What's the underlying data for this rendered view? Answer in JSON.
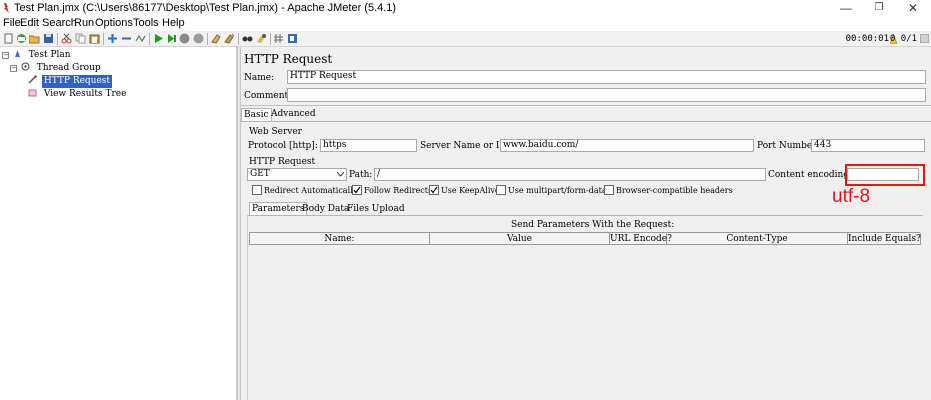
{
  "window": {
    "title": "Test Plan.jmx (C:\\Users\\86177\\Desktop\\Test Plan.jmx) - Apache JMeter (5.4.1)",
    "minimize_glyph": "—",
    "maximize_glyph": "❐",
    "close_glyph": "✕"
  },
  "menu": [
    "File",
    "Edit",
    "Search",
    "Run",
    "Options",
    "Tools",
    "Help"
  ],
  "toolbar": {
    "timer": "00:00:01",
    "thread_count": "0 0/1",
    "icons": [
      "new-icon",
      "templates-icon",
      "open-icon",
      "save-icon",
      "cut-icon",
      "copy-icon",
      "paste-icon",
      "expand-icon",
      "collapse-icon",
      "toggle-icon",
      "start-icon",
      "start-no-pause-icon",
      "stop-icon",
      "shutdown-icon",
      "clear-icon",
      "clear-all-icon",
      "search-icon",
      "reset-search-icon",
      "function-helper-icon",
      "help-icon"
    ]
  },
  "tree": {
    "items": [
      {
        "label": "Test Plan",
        "level": 0,
        "expander": "−",
        "icon": "test-plan-icon"
      },
      {
        "label": "Thread Group",
        "level": 1,
        "expander": "−",
        "icon": "thread-group-icon"
      },
      {
        "label": "HTTP Request",
        "level": 2,
        "selected": true,
        "icon": "sampler-icon"
      },
      {
        "label": "View Results Tree",
        "level": 2,
        "icon": "listener-icon"
      }
    ]
  },
  "panel": {
    "title": "HTTP Request",
    "name_label": "Name:",
    "name_value": "HTTP Request",
    "comments_label": "Comments:",
    "comments_value": "",
    "tabs": [
      "Basic",
      "Advanced"
    ],
    "active_tab": "Basic",
    "web_server": {
      "legend": "Web Server",
      "protocol_label": "Protocol [http]:",
      "protocol_value": "https",
      "server_label": "Server Name or IP:",
      "server_value": "www.baidu.com/",
      "port_label": "Port Number:",
      "port_value": "443"
    },
    "http_request": {
      "legend": "HTTP Request",
      "method": "GET",
      "path_label": "Path:",
      "path_value": "/",
      "encoding_label": "Content encoding:",
      "encoding_value": ""
    },
    "checkboxes": [
      {
        "label": "Redirect Automatically",
        "checked": false
      },
      {
        "label": "Follow Redirects",
        "checked": true
      },
      {
        "label": "Use KeepAlive",
        "checked": true
      },
      {
        "label": "Use multipart/form-data",
        "checked": false
      },
      {
        "label": "Browser-compatible headers",
        "checked": false
      }
    ],
    "sub_tabs": [
      "Parameters",
      "Body Data",
      "Files Upload"
    ],
    "active_sub_tab": "Parameters",
    "params_heading": "Send Parameters With the Request:",
    "columns": [
      "Name:",
      "Value",
      "URL Encode?",
      "Content-Type",
      "Include Equals?"
    ]
  },
  "annotation": {
    "text": "utf-8",
    "color": "#e8140e"
  },
  "colors": {
    "selection": "#2f62c7",
    "panel_bg": "#f0f0f0",
    "annotation_red": "#e8140e"
  }
}
